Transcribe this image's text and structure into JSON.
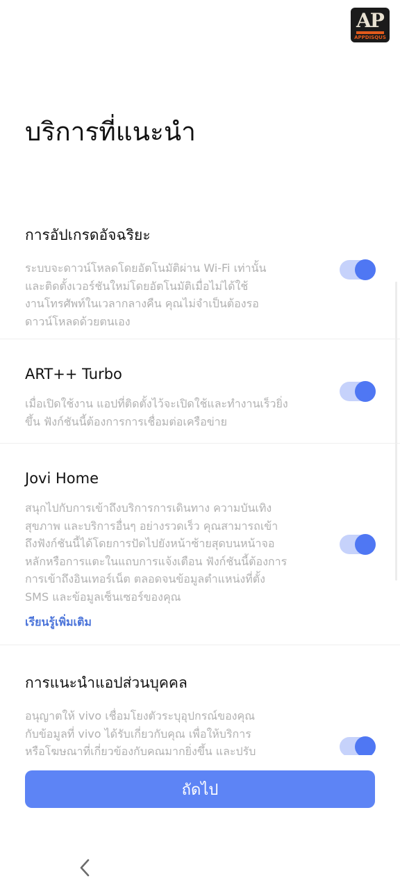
{
  "watermark": {
    "logo_text": "AP",
    "logo_sub": "APPDISQUS"
  },
  "page": {
    "title": "บริการที่แนะนำ"
  },
  "items": [
    {
      "title": "การอัปเกรดอัจฉริยะ",
      "desc_lines": [
        "ระบบจะดาวน์โหลดโดยอัตโนมัติผ่าน Wi-Fi เท่านั้น",
        "และติดตั้งเวอร์ชันใหม่โดยอัตโนมัติเมื่อไม่ได้ใช้",
        "งานโทรศัพท์ในเวลากลางคืน คุณไม่จำเป็นต้องรอ",
        "ดาวน์โหลดด้วยตนเอง"
      ],
      "enabled": true
    },
    {
      "title": "ART++ Turbo",
      "desc_lines": [
        "เมื่อเปิดใช้งาน แอปที่ติดตั้งไว้จะเปิดใช้และทำงานเร็วยิ่ง",
        "ขึ้น ฟังก์ชันนี้ต้องการการเชื่อมต่อเครือข่าย"
      ],
      "enabled": true
    },
    {
      "title": "Jovi Home",
      "desc_lines": [
        "สนุกไปกับการเข้าถึงบริการการเดินทาง ความบันเทิง",
        "สุขภาพ และบริการอื่นๆ อย่างรวดเร็ว คุณสามารถเข้า",
        "ถึงฟังก์ชันนี้ได้โดยการปัดไปยังหน้าซ้ายสุดบนหน้าจอ",
        "หลักหรือการแตะในแถบการแจ้งเตือน ฟังก์ชันนี้ต้องการ",
        "การเข้าถึงอินเทอร์เน็ต ตลอดจนข้อมูลตำแหน่งที่ตั้ง",
        "SMS และข้อมูลเซ็นเซอร์ของคุณ"
      ],
      "link": "เรียนรู้เพิ่มเติม",
      "enabled": true
    },
    {
      "title": "การแนะนำแอปส่วนบุคคล",
      "desc_lines": [
        "อนุญาตให้ vivo เชื่อมโยงตัวระบุอุปกรณ์ของคุณ",
        "กับข้อมูลที่ vivo ได้รับเกี่ยวกับคุณ เพื่อให้บริการ",
        "หรือโฆษณาที่เกี่ยวข้องกับคุณมากยิ่งขึ้น และปรับ"
      ],
      "enabled": true
    }
  ],
  "next_button": {
    "label": "ถัดไป"
  },
  "colors": {
    "accent": "#4f77f3",
    "button": "#5d84f5",
    "toggle_track": "#c6d2fb",
    "desc_text": "#b1b1b1"
  },
  "nav": {
    "back_icon": "chevron-left-icon"
  }
}
